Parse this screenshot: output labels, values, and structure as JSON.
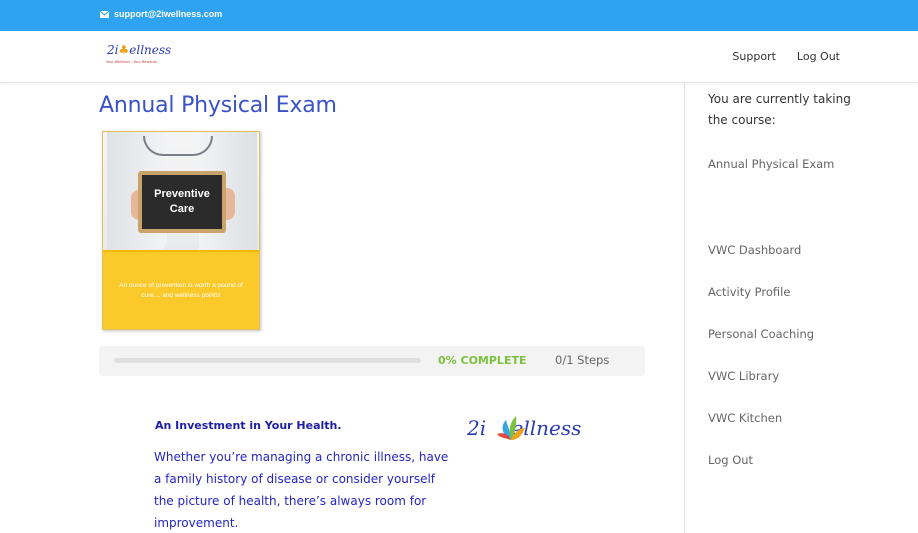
{
  "topbar": {
    "email": "support@2iwellness.com",
    "color": "#2ea3f2"
  },
  "header": {
    "logo_text": "2i Wellness",
    "logo_tagline": "Your Wellness - Your Rewards",
    "nav": [
      "Support",
      "Log Out"
    ]
  },
  "main": {
    "title": "Annual Physical Exam",
    "card": {
      "board_line1": "Preventive",
      "board_line2": "Care",
      "caption": "An ounce of prevention is worth a pound of cure… and wellness points!"
    },
    "progress": {
      "percent": 0,
      "label": "0% COMPLETE",
      "steps": "0/1 Steps"
    },
    "content": {
      "heading": "An Investment in Your Health.",
      "body": "Whether you’re managing a chronic illness, have a family history of disease or consider yourself the picture of health, there’s always room for improvement.",
      "logo_text": "2i Wellness"
    }
  },
  "sidebar": {
    "current_label": "You are currently taking the course:",
    "current_course": "Annual Physical Exam",
    "links": [
      "VWC Dashboard",
      "Activity Profile",
      "Personal Coaching",
      "VWC Library",
      "VWC Kitchen",
      "Log Out"
    ]
  },
  "colors": {
    "accent_blue": "#2ea3f2",
    "title_blue": "#3a52c8",
    "progress_green": "#7dc140",
    "card_yellow": "#fcc92a"
  },
  "icons": [
    "mail-icon",
    "logo-leaf-icon"
  ]
}
